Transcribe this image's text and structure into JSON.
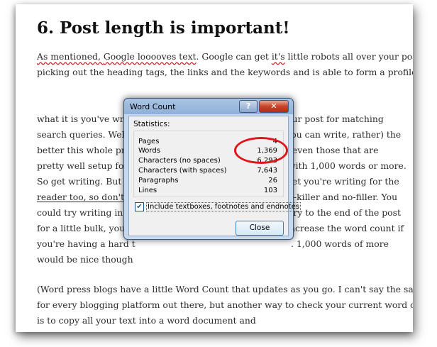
{
  "article": {
    "heading": "6. Post length is important!",
    "line1_a": "As mentioned, ",
    "line1_b": "Google looooves text",
    "line1_c": ". Google can get ",
    "line1_d": "it's",
    "line1_e": " little robots all over your post,",
    "line2": "picking out the heading tags, the links and the keywords and is able to form a profile of",
    "line3_left": "what it is you've writ",
    "line3_right": "our post for matching",
    "line4_left": "search queries. Well, ",
    "line4_right": "e you can write, rather) the",
    "line5_left": "better this whole pro",
    "line5_right": ", even those that are",
    "line6_left": "pretty well setup for S",
    "line6_right": "with 1,000 words or more.",
    "line7_left": "So get writing.  But as",
    "line7_right": "get you're writing for the",
    "line8_left": "reader too, so don't ju",
    "line8_right": "ll-killer and no-filler. You",
    "line9_left": "could try writing in a",
    "line9_right": "ary to the end of the post",
    "line10_left": "for a little bulk, you c",
    "line10_right": "increase the word count if",
    "line11_left": "you're having a hard t",
    "line11_right": ". 1,000 words of more",
    "line12_left": "would be nice though",
    "line13": "(Word press blogs have a little Word Count that updates as you go. I can't say the same",
    "line14": "for every blogging platform out there, but another way to check your current word count",
    "line15": "is to copy all your text into a word document and"
  },
  "dialog": {
    "title": "Word Count",
    "help_label": "?",
    "close_x_label": "✕",
    "statistics_label": "Statistics:",
    "stats": [
      {
        "label": "Pages",
        "value": "4"
      },
      {
        "label": "Words",
        "value": "1,369"
      },
      {
        "label": "Characters (no spaces)",
        "value": "6,293"
      },
      {
        "label": "Characters (with spaces)",
        "value": "7,643"
      },
      {
        "label": "Paragraphs",
        "value": "26"
      },
      {
        "label": "Lines",
        "value": "103"
      }
    ],
    "include_label": "Include textboxes, footnotes and endnotes",
    "include_checked_mark": "✔",
    "close_button_label": "Close"
  },
  "colors": {
    "annotation": "#e0141b",
    "spellcheck": "#c0262c"
  }
}
